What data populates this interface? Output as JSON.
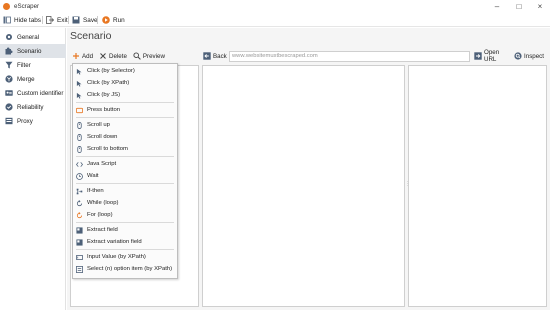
{
  "window": {
    "title": "eScraper"
  },
  "toolbar": {
    "hide_tabs": "Hide tabs",
    "exit": "Exit",
    "save": "Save",
    "run": "Run"
  },
  "sidebar": {
    "items": [
      {
        "label": "General",
        "icon": "gear-icon"
      },
      {
        "label": "Scenario",
        "icon": "puzzle-icon",
        "active": true
      },
      {
        "label": "Filter",
        "icon": "filter-icon"
      },
      {
        "label": "Merge",
        "icon": "merge-icon"
      },
      {
        "label": "Custom identifier",
        "icon": "id-card-icon"
      },
      {
        "label": "Reliability",
        "icon": "shield-icon"
      },
      {
        "label": "Proxy",
        "icon": "proxy-icon"
      }
    ]
  },
  "main": {
    "title": "Scenario",
    "left_toolbar": {
      "add": "Add",
      "delete": "Delete",
      "preview": "Preview"
    },
    "browser_toolbar": {
      "back": "Back",
      "url_placeholder": "www.websitemustbescraped.com",
      "open_url": "Open URL",
      "inspect": "Inspect"
    }
  },
  "add_menu": {
    "groups": [
      [
        "Click (by Selector)",
        "Click (by XPath)",
        "Click (by JS)"
      ],
      [
        "Press button"
      ],
      [
        "Scroll up",
        "Scroll down",
        "Scroll to bottom"
      ],
      [
        "Java Script",
        "Wait"
      ],
      [
        "If-then",
        "While (loop)",
        "For (loop)"
      ],
      [
        "Extract field",
        "Extract variation field"
      ],
      [
        "Input Value (by XPath)",
        "Select (n) option item (by XPath)"
      ]
    ]
  },
  "colors": {
    "accent_orange": "#e87722",
    "active_bg": "#dfe3e8",
    "menu_highlight": "#e6eef8"
  }
}
